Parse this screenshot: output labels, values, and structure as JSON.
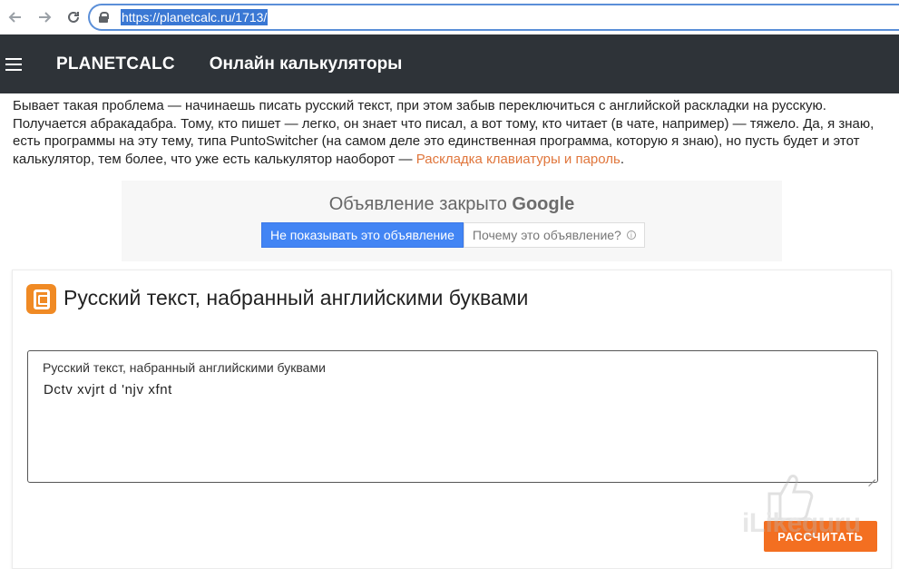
{
  "browser": {
    "url": "https://planetcalc.ru/1713/",
    "back_icon": "arrow-left-icon",
    "forward_icon": "arrow-right-icon",
    "reload_icon": "reload-icon"
  },
  "header": {
    "brand": "PLANETCALC",
    "title": "Онлайн калькуляторы",
    "background": "#2e3338"
  },
  "intro": {
    "text": "Бывает такая проблема — начинаешь писать русский текст, при этом забыв переключиться с английской раскладки на русскую. Получается абракадабра. Тому, кто пишет — легко, он знает что писал, а вот тому, кто читает (в чате, например) — тяжело. Да, я знаю, есть программы на эту тему, типа PuntoSwitcher (на самом деле это единственная программа, которую я знаю), но пусть будет и этот калькулятор, тем более, что уже есть калькулятор наоборот — ",
    "link_text": "Раскладка клавиатуры и пароль",
    "trailing": ".",
    "link_color": "#e0763c"
  },
  "ad": {
    "closed_text": "Объявление закрыто",
    "google_label": "Google",
    "hide_button": "Не показывать это объявление",
    "why_button": "Почему это объявление?"
  },
  "calculator": {
    "title": "Русский текст, набранный английскими буквами",
    "input_label": "Русский текст, набранный английскими буквами",
    "input_value": "Dctv xvjrt d 'njv xfnt",
    "calculate_button": "РАССЧИТАТЬ",
    "accent": "#f36f21"
  },
  "watermark": {
    "text": "iLikeguru"
  }
}
